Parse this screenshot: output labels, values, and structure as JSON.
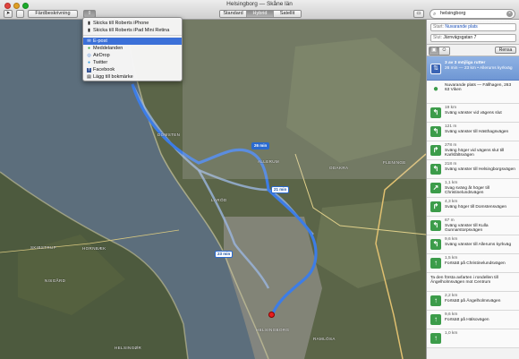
{
  "window": {
    "title": "Helsingborg — Skåne län"
  },
  "toolbar": {
    "directions_label": "Färdbeskrivning",
    "view_modes": [
      "Standard",
      "Hybrid",
      "Satellit"
    ],
    "active_view": "Hybrid",
    "search_value": "helsingborg"
  },
  "share_menu": {
    "items": [
      {
        "label": "Skicka till Roberts iPhone",
        "icon": "iphone-icon"
      },
      {
        "label": "Skicka till Roberts iPad Mini Retina",
        "icon": "ipad-icon"
      },
      {
        "label": "E-post",
        "icon": "mail-icon",
        "selected": true
      },
      {
        "label": "Meddelanden",
        "icon": "messages-icon"
      },
      {
        "label": "AirDrop",
        "icon": "airdrop-icon"
      },
      {
        "label": "Twitter",
        "icon": "twitter-icon"
      },
      {
        "label": "Facebook",
        "icon": "facebook-icon"
      },
      {
        "label": "Lägg till bokmärke",
        "icon": "bookmark-icon"
      }
    ]
  },
  "map": {
    "labels": [
      {
        "text": "DOMSTEN"
      },
      {
        "text": "ODAKRA"
      },
      {
        "text": "ALLERUM"
      },
      {
        "text": "FLENINGE"
      },
      {
        "text": "LARÖD"
      },
      {
        "text": "HELSINGBORG"
      },
      {
        "text": "HELSINGØR"
      },
      {
        "text": "HORNBÆK"
      },
      {
        "text": "SKIBSTRUP"
      },
      {
        "text": "NISGÅRD"
      },
      {
        "text": "RAMLÖSA"
      }
    ],
    "route_tags": [
      "26 min",
      "21 min",
      "23 min"
    ]
  },
  "sidebar": {
    "start_key": "Start:",
    "start_value": "Nuvarande plats",
    "end_key": "Slut:",
    "end_value": "Järnvägsgatan 7",
    "clear_label": "Rensa",
    "summary_line1": "3 av 3 möjliga rutter",
    "summary_line2": "26 min — 23 km • Allerums kyrkväg",
    "start_place": "Nuvarande plats — Fällhagen, 263 63 Viken",
    "steps": [
      {
        "dist": "19 km",
        "text": "Sväng vänster vid vägens slut",
        "icon": "turn-left-icon",
        "glyph": "↰"
      },
      {
        "dist": "121 m",
        "text": "Sväng vänster till Hästhagsvägen",
        "icon": "turn-left-icon",
        "glyph": "↰"
      },
      {
        "dist": "278 m",
        "text": "Sväng höger vid vägens slut till Karlsfältsvägen",
        "icon": "turn-right-icon",
        "glyph": "↱"
      },
      {
        "dist": "218 m",
        "text": "Sväng vänster till Helsingborgsvägen",
        "icon": "turn-left-icon",
        "glyph": "↰"
      },
      {
        "dist": "1,1 km",
        "text": "Svag sväng åt höger till Christinelundsvägen",
        "icon": "slight-right-icon",
        "glyph": "↗"
      },
      {
        "dist": "4,3 km",
        "text": "Sväng höger till Domstensvägen",
        "icon": "turn-right-icon",
        "glyph": "↱"
      },
      {
        "dist": "67 m",
        "text": "Sväng vänster till Kulla Gunnarstorpsvägen",
        "icon": "turn-left-icon",
        "glyph": "↰"
      },
      {
        "dist": "9,6 km",
        "text": "Sväng vänster till Allerums kyrkväg",
        "icon": "turn-left-icon",
        "glyph": "↰"
      },
      {
        "dist": "1,5 km",
        "text": "Fortsätt på Christinelundsvägen",
        "icon": "straight-icon",
        "glyph": "↑"
      }
    ],
    "note": "Ta den första avfarten i rondellen till Ängelholmsvägen mot Centrum",
    "tail_steps": [
      {
        "dist": "2,2 km",
        "text": "Fortsätt på Ängelholmsvägen",
        "icon": "straight-icon",
        "glyph": "↑"
      },
      {
        "dist": "9,6 km",
        "text": "Fortsätt på Hälsovägen",
        "icon": "straight-icon",
        "glyph": "↑"
      },
      {
        "dist": "1,0 km",
        "text": "",
        "icon": "straight-icon",
        "glyph": "↑"
      }
    ]
  }
}
